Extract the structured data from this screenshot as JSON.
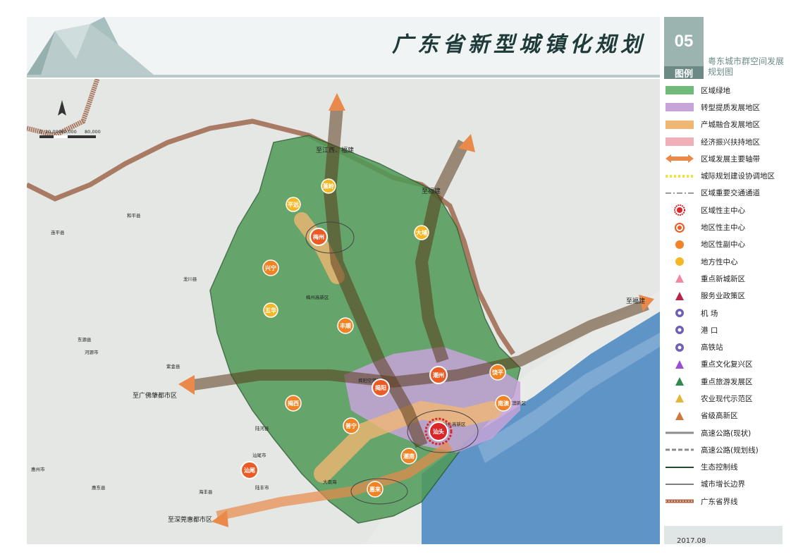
{
  "header": {
    "title": "广东省新型城镇化规划",
    "number": "05",
    "subtitle": "粤东城市群空间发展规划图",
    "legend_heading": "图例",
    "date": "2017.08"
  },
  "map": {
    "scale_labels": [
      "0",
      "20,000",
      "40,000",
      "80,000"
    ],
    "direction_labels": {
      "jiangxi_fujian": "至江西、福建",
      "fujian_ne": "至福建",
      "fujian_e": "至福建",
      "guangfo": "至广佛肇都市区",
      "shenzhen": "至深莞惠都市区"
    },
    "centers": {
      "main": "汕头",
      "regional": [
        "梅州",
        "潮州",
        "揭阳",
        "汕尾"
      ],
      "sub_regional": [
        "兴宁",
        "丰顺",
        "揭西",
        "普宁",
        "惠来",
        "潮南",
        "饶平",
        "南澳"
      ],
      "local": [
        "平远",
        "蕉岭",
        "大埔",
        "五华"
      ]
    },
    "place_labels": [
      "和平县",
      "连平县",
      "龙川县",
      "东源县",
      "河源市",
      "紫金县",
      "陆河县",
      "海丰县",
      "陆丰市",
      "惠州市",
      "惠东县",
      "汕尾市",
      "大南海",
      "梅州高新区",
      "揭阳空港新区",
      "汕头高新区",
      "南澳新区"
    ]
  },
  "legend": [
    {
      "icon": "green-area",
      "label": "区域绿地",
      "color": "#6fb97a"
    },
    {
      "icon": "purple-area",
      "label": "转型提质发展地区",
      "color": "#c6a3d8"
    },
    {
      "icon": "orange-area",
      "label": "产城融合发展地区",
      "color": "#f0b773"
    },
    {
      "icon": "pink-area",
      "label": "经济振兴扶持地区",
      "color": "#f1b0b8"
    },
    {
      "icon": "double-arrow",
      "label": "区域发展主要轴带",
      "color": "#e98a4a"
    },
    {
      "icon": "yellow-dash",
      "label": "城际规划建设协调地区",
      "color": "#f2e23a"
    },
    {
      "icon": "grey-dashdot",
      "label": "区域重要交通通道",
      "color": "#9a9a9a"
    },
    {
      "icon": "red-ring-center",
      "label": "区域性主中心",
      "color": "#d8262a"
    },
    {
      "icon": "orange-ring-center",
      "label": "地区性主中心",
      "color": "#ea5b25"
    },
    {
      "icon": "orange-dot",
      "label": "地区性副中心",
      "color": "#f08324"
    },
    {
      "icon": "yellow-dot",
      "label": "地方性中心",
      "color": "#f4b826"
    },
    {
      "icon": "pink-triangle",
      "label": "重点新城新区",
      "color": "#f08aa0"
    },
    {
      "icon": "crimson-triangle",
      "label": "服务业政策区",
      "color": "#b5254a"
    },
    {
      "icon": "airport-icon",
      "label": "机 场",
      "color": "#7260b5"
    },
    {
      "icon": "port-icon",
      "label": "港 口",
      "color": "#7260b5"
    },
    {
      "icon": "rail-icon",
      "label": "高铁站",
      "color": "#7260b5"
    },
    {
      "icon": "violet-triangle",
      "label": "重点文化复兴区",
      "color": "#9a4ed1"
    },
    {
      "icon": "green-triangle",
      "label": "重点旅游发展区",
      "color": "#2f8a4b"
    },
    {
      "icon": "gold-triangle",
      "label": "农业现代示范区",
      "color": "#e0b63b"
    },
    {
      "icon": "brown-triangle",
      "label": "省级高新区",
      "color": "#cc7a3e"
    },
    {
      "icon": "highway-solid",
      "label": "高速公路(现状)",
      "color": "#8c8c8c"
    },
    {
      "icon": "highway-dashed",
      "label": "高速公路(规划线)",
      "color": "#8c8c8c"
    },
    {
      "icon": "eco-line",
      "label": "生态控制线",
      "color": "#234d2a"
    },
    {
      "icon": "growth-line",
      "label": "城市增长边界",
      "color": "#555555"
    },
    {
      "icon": "province-line",
      "label": "广东省界线",
      "color": "#b06848"
    }
  ]
}
